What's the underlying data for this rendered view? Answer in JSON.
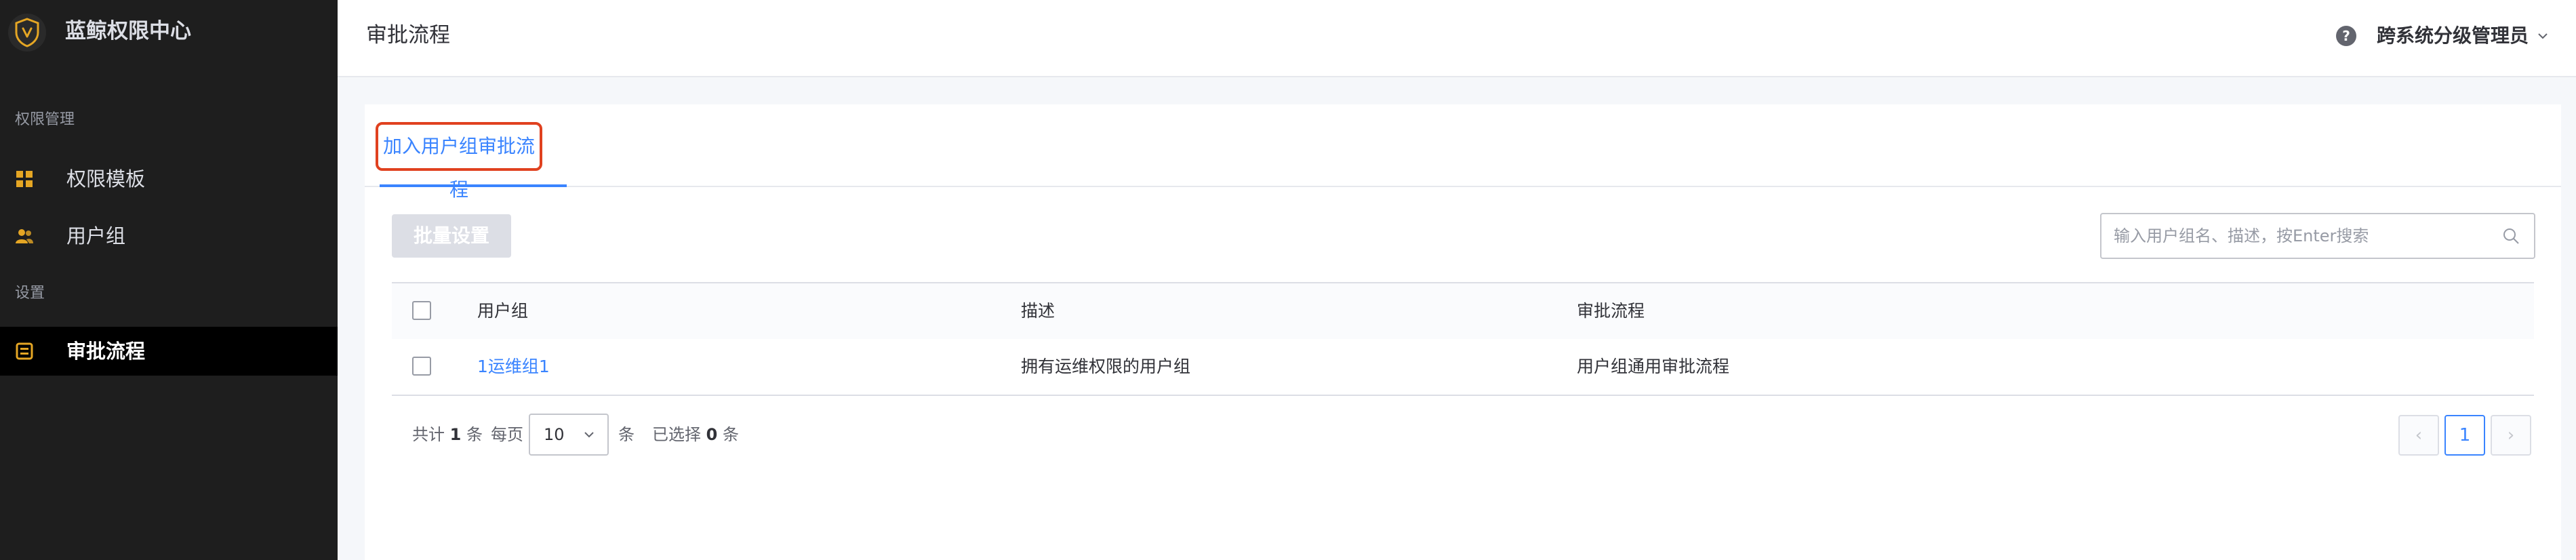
{
  "app": {
    "title": "蓝鲸权限中心"
  },
  "sidebar": {
    "groups": [
      {
        "label": "权限管理"
      },
      {
        "label": "设置"
      }
    ],
    "items": [
      {
        "label": "权限模板",
        "icon": "grid-icon"
      },
      {
        "label": "用户组",
        "icon": "users-icon"
      },
      {
        "label": "审批流程",
        "icon": "approval-icon",
        "active": true
      }
    ]
  },
  "header": {
    "title": "审批流程",
    "help_icon": "?",
    "user": "跨系统分级管理员"
  },
  "tabs": [
    {
      "label": "加入用户组审批流程",
      "active": true
    }
  ],
  "toolbar": {
    "batch_label": "批量设置",
    "search_placeholder": "输入用户组名、描述，按Enter搜索"
  },
  "table": {
    "columns": [
      "用户组",
      "描述",
      "审批流程"
    ],
    "rows": [
      {
        "group": "1运维组1",
        "description": "拥有运维权限的用户组",
        "process": "用户组通用审批流程"
      }
    ]
  },
  "pagination": {
    "total_prefix": "共计",
    "total": "1",
    "total_suffix": "条",
    "per_page_prefix": "每页",
    "per_page": "10",
    "per_page_suffix": "条",
    "selected_prefix": "已选择",
    "selected": "0",
    "selected_suffix": "条",
    "prev": "‹",
    "current_page": "1",
    "next": "›"
  },
  "colors": {
    "sidebar_bg": "#1e1e1e",
    "accent": "#3a84ff",
    "highlight_border": "#e0411f",
    "icon_gold": "#e5a624"
  }
}
